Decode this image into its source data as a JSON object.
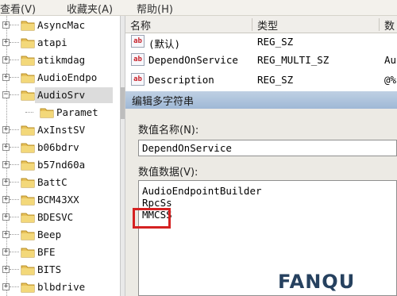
{
  "menubar": {
    "items": [
      "查看(V)",
      "收藏夹(A)",
      "帮助(H)"
    ]
  },
  "tree": {
    "items": [
      {
        "label": "AsyncMac",
        "expander": "+"
      },
      {
        "label": "atapi",
        "expander": "+"
      },
      {
        "label": "atikmdag",
        "expander": "+"
      },
      {
        "label": "AudioEndpo",
        "expander": "+"
      },
      {
        "label": "AudioSrv",
        "expander": "−",
        "selected": true
      },
      {
        "label": "Paramet",
        "child": true
      },
      {
        "label": "AxInstSV",
        "expander": "+"
      },
      {
        "label": "b06bdrv",
        "expander": "+"
      },
      {
        "label": "b57nd60a",
        "expander": "+"
      },
      {
        "label": "BattC",
        "expander": "+"
      },
      {
        "label": "BCM43XX",
        "expander": "+"
      },
      {
        "label": "BDESVC",
        "expander": "+"
      },
      {
        "label": "Beep",
        "expander": "+"
      },
      {
        "label": "BFE",
        "expander": "+"
      },
      {
        "label": "BITS",
        "expander": "+"
      },
      {
        "label": "blbdrive",
        "expander": "+"
      }
    ]
  },
  "values_list": {
    "columns": [
      "名称",
      "类型",
      "数"
    ],
    "rows": [
      {
        "name": "(默认)",
        "type": "REG_SZ",
        "data": ""
      },
      {
        "name": "DependOnService",
        "type": "REG_MULTI_SZ",
        "data": "Au"
      },
      {
        "name": "Description",
        "type": "REG_SZ",
        "data": "@%"
      }
    ]
  },
  "dialog": {
    "title": "编辑多字符串",
    "name_label": "数值名称(N):",
    "name_value": "DependOnService",
    "data_label": "数值数据(V):",
    "data_lines": [
      "AudioEndpointBuilder",
      "RpcSs",
      "MMCSS"
    ]
  },
  "watermark": {
    "text": "FANQU"
  },
  "colors": {
    "highlight_border": "#d52222",
    "dialog_title_bg": "#a8bfdb",
    "selection_bg": "#dcdcdc",
    "folder": "#e8c25a"
  }
}
